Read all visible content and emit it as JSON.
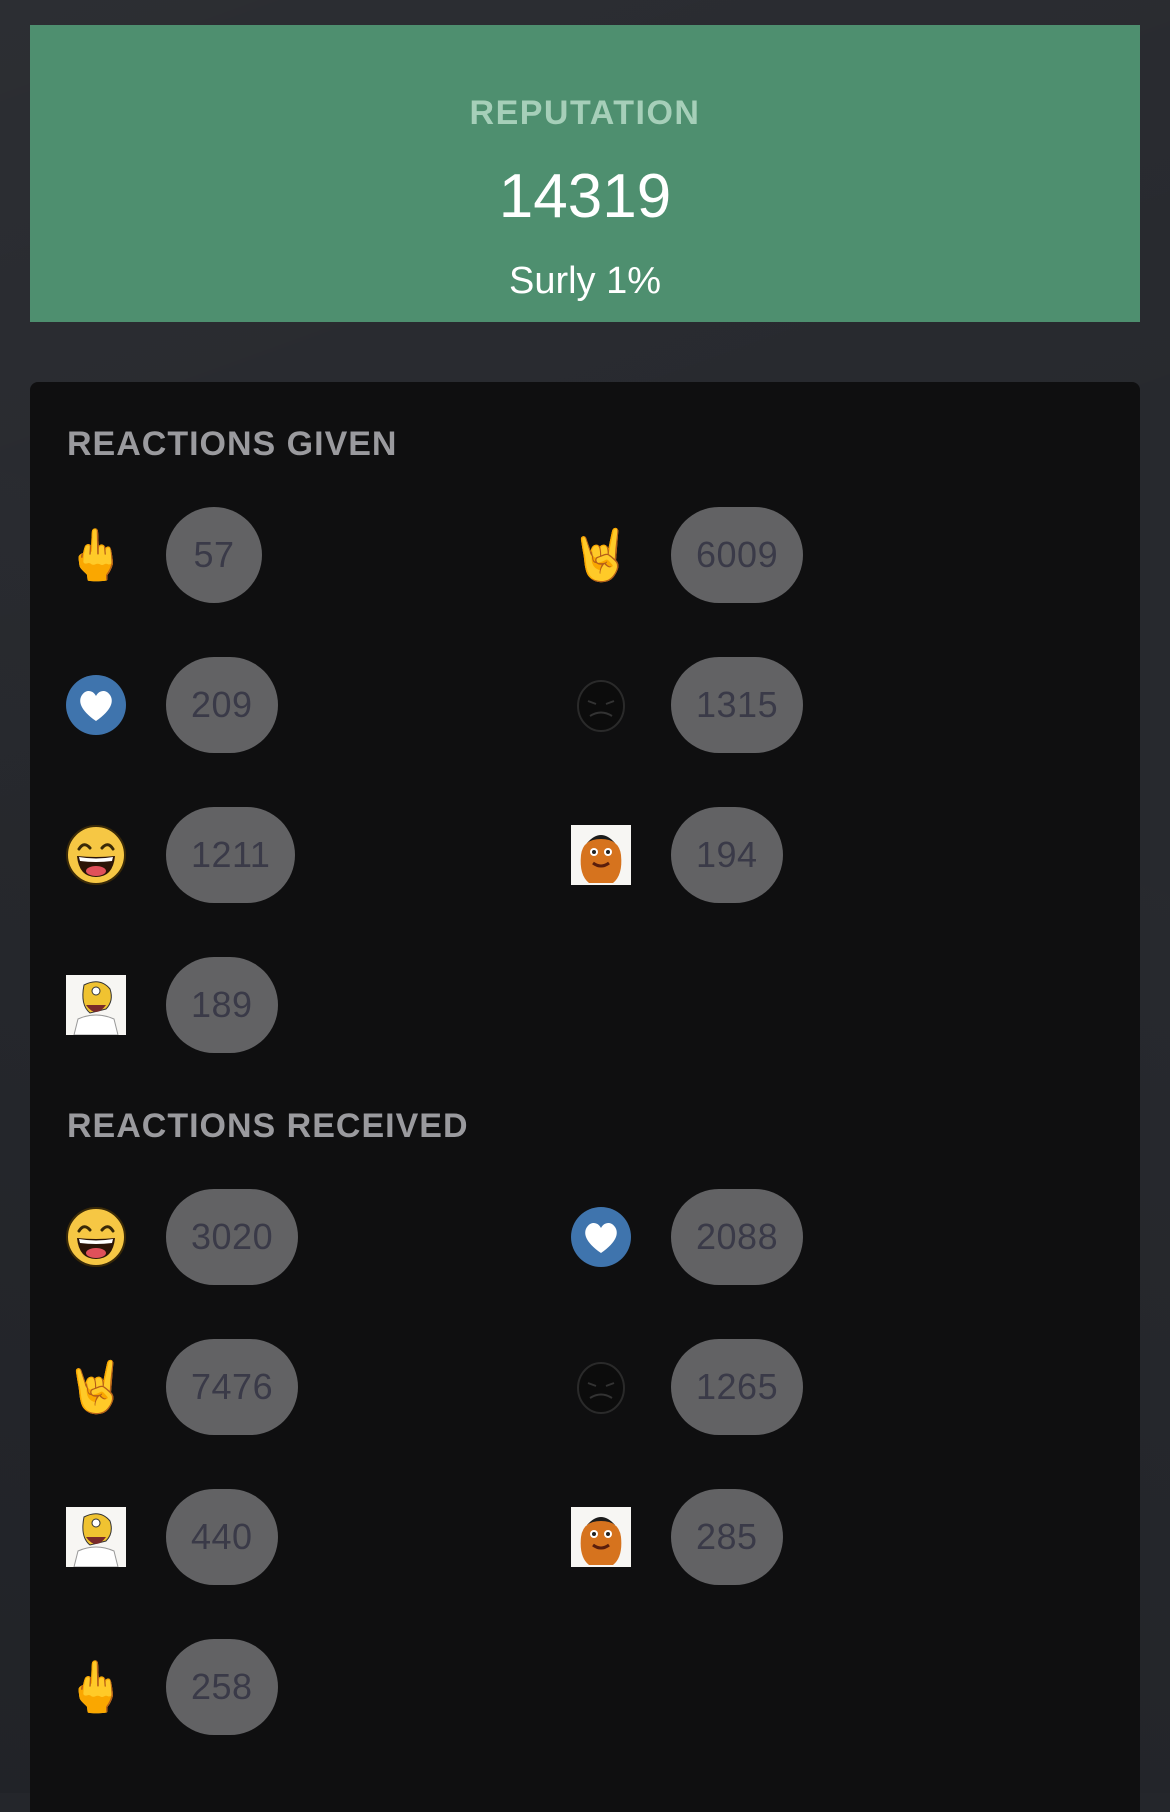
{
  "reputation": {
    "title": "REPUTATION",
    "value": "14319",
    "rank": "Surly 1%",
    "card_color": "#4e8f6f"
  },
  "reactions_given": {
    "title": "REACTIONS GIVEN",
    "items": [
      {
        "icon": "middle-finger-icon",
        "count": "57"
      },
      {
        "icon": "rock-on-hand-icon",
        "count": "6009"
      },
      {
        "icon": "heart-icon",
        "count": "209"
      },
      {
        "icon": "dark-rage-face-icon",
        "count": "1315"
      },
      {
        "icon": "laughing-face-icon",
        "count": "1211"
      },
      {
        "icon": "orange-mascot-icon",
        "count": "194"
      },
      {
        "icon": "cartoon-drooling-man-icon",
        "count": "189"
      }
    ]
  },
  "reactions_received": {
    "title": "REACTIONS RECEIVED",
    "items": [
      {
        "icon": "laughing-face-icon",
        "count": "3020"
      },
      {
        "icon": "heart-icon",
        "count": "2088"
      },
      {
        "icon": "rock-on-hand-icon",
        "count": "7476"
      },
      {
        "icon": "dark-rage-face-icon",
        "count": "1265"
      },
      {
        "icon": "cartoon-drooling-man-icon",
        "count": "440"
      },
      {
        "icon": "orange-mascot-icon",
        "count": "285"
      },
      {
        "icon": "middle-finger-icon",
        "count": "258"
      }
    ]
  },
  "colors": {
    "page_background": "#24262b",
    "panel_background": "#0f0f10",
    "pill_background": "#626264",
    "pill_text": "#3a3a48",
    "heart_blue": "#3f74ad"
  }
}
